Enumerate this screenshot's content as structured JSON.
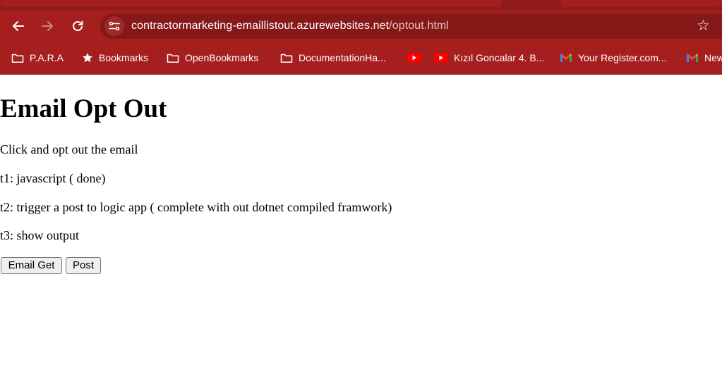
{
  "browser": {
    "url_host": "contractormarketing-emaillistout.azurewebsites.net",
    "url_path": "/optout.html",
    "bookmarks": [
      {
        "label": "P.A.R.A",
        "icon": "folder-icon"
      },
      {
        "label": "Bookmarks",
        "icon": "star-icon"
      },
      {
        "label": "OpenBookmarks",
        "icon": "folder-icon"
      },
      {
        "label": "DocumentationHa...",
        "icon": "folder-icon"
      },
      {
        "label": "",
        "icon": "youtube-icon"
      },
      {
        "label": "Kızıl Goncalar 4. B...",
        "icon": "youtube-icon"
      },
      {
        "label": "Your Register.com...",
        "icon": "gmail-icon"
      },
      {
        "label": "New",
        "icon": "gmail-icon"
      }
    ],
    "colors": {
      "frame": "#a51f1f",
      "omnibox": "#861818",
      "youtube": "#ff0000"
    }
  },
  "page": {
    "title": "Email Opt Out",
    "description": "Click and opt out the email",
    "tasks": [
      "t1: javascript ( done)",
      "t2: trigger a post to logic app ( complete with out dotnet compiled framwork)",
      "t3: show output"
    ],
    "buttons": {
      "email_get": "Email Get",
      "post": "Post"
    }
  }
}
